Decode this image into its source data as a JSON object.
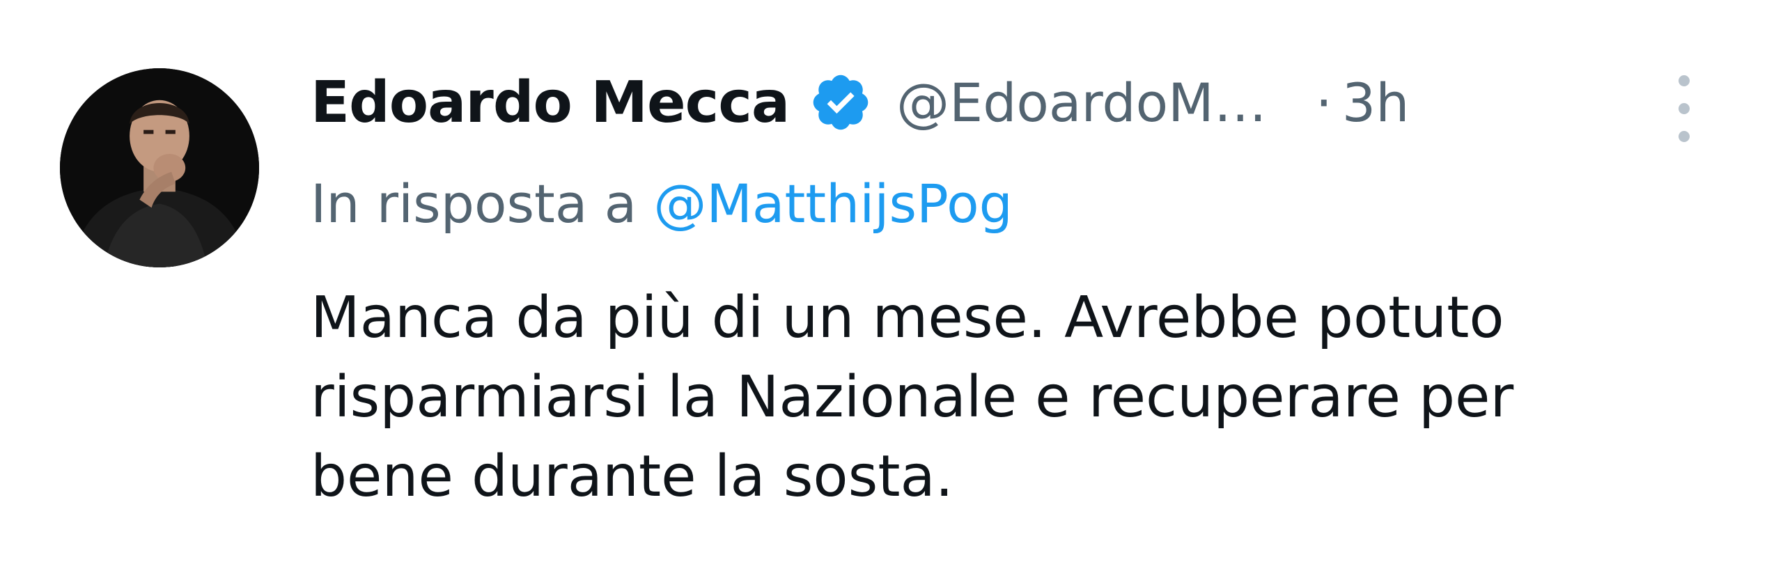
{
  "author": {
    "display_name": "Edoardo Mecca",
    "handle": "@EdoardoM…",
    "verified_icon": "verified-badge-icon",
    "avatar_icon": "profile-photo"
  },
  "meta": {
    "separator": "·",
    "time": "3h"
  },
  "reply": {
    "prefix": "In risposta a",
    "mention": "@MatthijsPog"
  },
  "tweet": {
    "lines": [
      "Manca da più di un mese. Avrebbe potuto",
      "risparmiarsi la Nazionale e recuperare per",
      "bene durante la sosta."
    ]
  },
  "colors": {
    "text": "#0f1419",
    "secondary": "#536471",
    "accent": "#1d9bf0"
  }
}
